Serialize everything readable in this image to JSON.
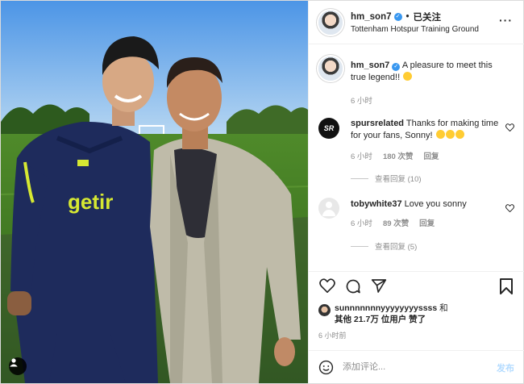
{
  "post": {
    "username": "hm_son7",
    "follow_label": "已关注",
    "location": "Tottenham Hotspur Training Ground",
    "caption": "A pleasure to meet this true legend!!",
    "caption_time": "6 小时",
    "jersey_text": "getir",
    "likes_user": "sunnnnnnnyyyyyyyyssss",
    "likes_and": "和",
    "likes_rest": "其他 21.7万 位用户 赞了",
    "post_time": "6 小时前"
  },
  "comments": [
    {
      "username": "spursrelated",
      "text": "Thanks for making time for your fans, Sonny!",
      "time": "6 小时",
      "likes": "180 次赞",
      "reply_label": "回复",
      "view_replies": "查看回复 (10)",
      "avatar_text": "SR"
    },
    {
      "username": "tobywhite37",
      "text": "Love you sonny",
      "time": "6 小时",
      "likes": "89 次赞",
      "reply_label": "回复",
      "view_replies": "查看回复 (5)"
    }
  ],
  "add_comment": {
    "placeholder": "添加评论...",
    "post_label": "发布"
  },
  "icons": {
    "like": "heart-icon",
    "comment": "comment-icon",
    "share": "paper-plane-icon",
    "save": "bookmark-icon",
    "emoji": "smiley-icon",
    "more": "more-options-icon",
    "tag": "user-tag-icon"
  },
  "colors": {
    "verified": "#3897f0",
    "post_button_disabled": "#b3dbff",
    "meta_text": "#8e8e8e"
  }
}
